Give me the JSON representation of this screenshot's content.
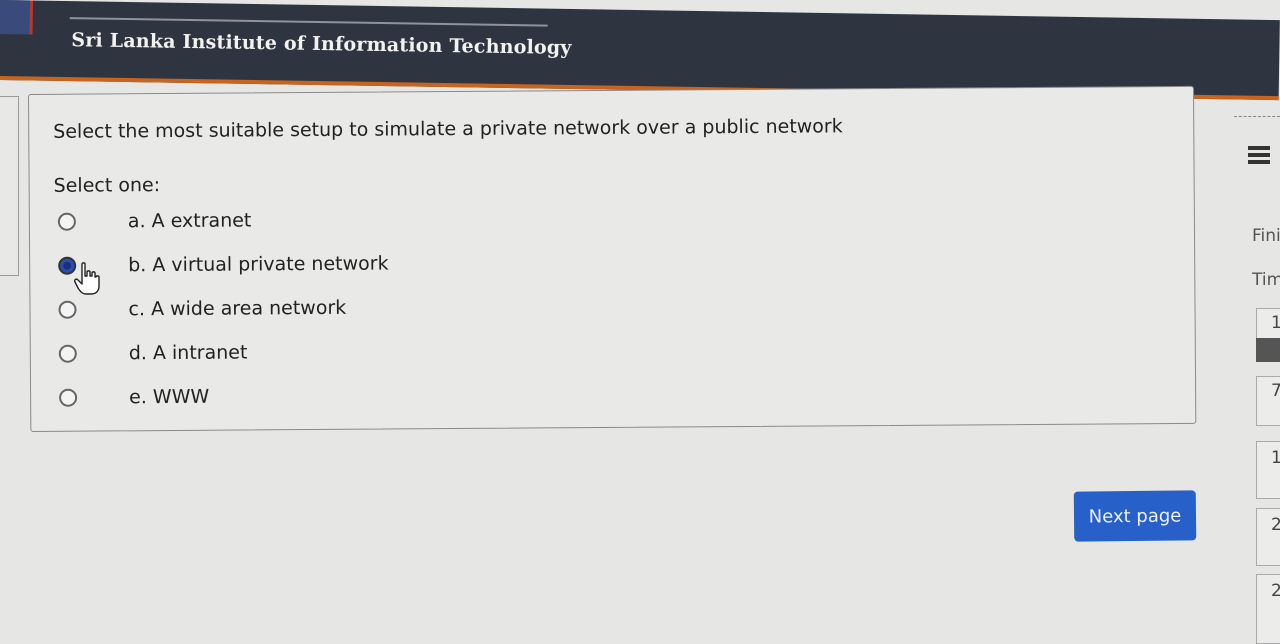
{
  "header": {
    "org_name": "Sri Lanka Institute of Information Technology"
  },
  "question": {
    "prompt": "Select the most suitable setup to simulate a private network over a public network",
    "instruction": "Select one:",
    "options": [
      {
        "label": "a. A extranet",
        "selected": false
      },
      {
        "label": "b. A virtual private network",
        "selected": true
      },
      {
        "label": "c. A wide area network",
        "selected": false
      },
      {
        "label": "d. A intranet",
        "selected": false
      },
      {
        "label": "e. WWW",
        "selected": false
      }
    ]
  },
  "navigation": {
    "next_label": "Next page"
  },
  "sidebar": {
    "menu_icon": "hamburger-icon",
    "finish_label": "Fini",
    "time_label": "Tim",
    "boxes": [
      "1",
      "7",
      "1",
      "2",
      "2"
    ]
  },
  "colors": {
    "header_bg": "#2f3540",
    "header_accent": "#c8641e",
    "button_bg": "#2660c8"
  }
}
